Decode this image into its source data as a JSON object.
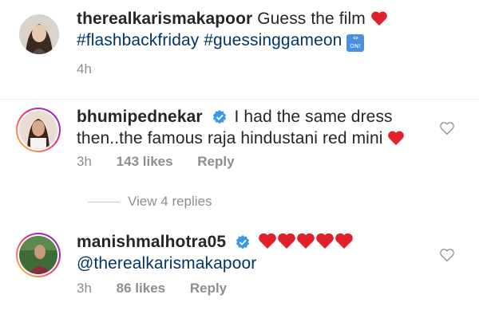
{
  "caption": {
    "username": "therealkarismakapoor",
    "text": "Guess the film",
    "hashtags": "#flashbackfriday #guessinggameon",
    "on_icon_label": "ON!",
    "time": "4h"
  },
  "comments": [
    {
      "username": "bhumipednekar",
      "verified": true,
      "text_line1": "I had the same dress",
      "text_line2": "then..the famous raja hindustani red mini",
      "time": "3h",
      "likes": "143 likes",
      "reply_label": "Reply"
    },
    {
      "username": "manishmalhotra05",
      "verified": true,
      "mention": "@therealkarismakapoor",
      "time": "3h",
      "likes": "86 likes",
      "reply_label": "Reply"
    }
  ],
  "view_replies_label": "View 4 replies",
  "colors": {
    "heart": "#e0202a",
    "verified": "#3897f0",
    "link": "#003569",
    "meta": "#8e8e8e"
  }
}
